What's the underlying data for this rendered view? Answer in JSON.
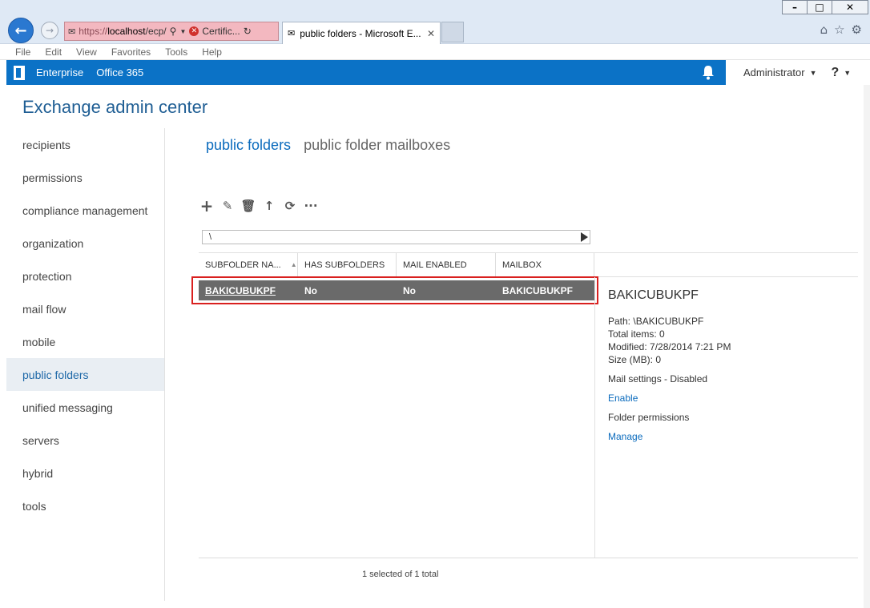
{
  "browser": {
    "address": {
      "prefix": "https://",
      "host": "localhost",
      "path": "/ecp/",
      "cert_label": "Certific..."
    },
    "tab_title": "public folders - Microsoft E...",
    "menu": [
      "File",
      "Edit",
      "View",
      "Favorites",
      "Tools",
      "Help"
    ]
  },
  "topnav": {
    "enterprise": "Enterprise",
    "office365": "Office 365",
    "admin": "Administrator",
    "help": "?"
  },
  "app_title": "Exchange admin center",
  "sidebar": {
    "items": [
      {
        "label": "recipients"
      },
      {
        "label": "permissions"
      },
      {
        "label": "compliance management"
      },
      {
        "label": "organization"
      },
      {
        "label": "protection"
      },
      {
        "label": "mail flow"
      },
      {
        "label": "mobile"
      },
      {
        "label": "public folders",
        "active": true
      },
      {
        "label": "unified messaging"
      },
      {
        "label": "servers"
      },
      {
        "label": "hybrid"
      },
      {
        "label": "tools"
      }
    ]
  },
  "tabs": [
    "public folders",
    "public folder mailboxes"
  ],
  "path": "\\",
  "grid": {
    "columns": [
      "SUBFOLDER NA...",
      "HAS SUBFOLDERS",
      "MAIL ENABLED",
      "MAILBOX"
    ],
    "rows": [
      [
        "BAKICUBUKPF",
        "No",
        "No",
        "BAKICUBUKPF"
      ]
    ]
  },
  "details": {
    "title": "BAKICUBUKPF",
    "path": "Path: \\BAKICUBUKPF",
    "total_items": "Total items: 0",
    "modified": "Modified: 7/28/2014 7:21 PM",
    "size": "Size (MB): 0",
    "mail_settings": "Mail settings - Disabled",
    "enable_link": "Enable",
    "folder_permissions": "Folder permissions",
    "manage_link": "Manage"
  },
  "status": "1 selected of 1 total",
  "colors": {
    "accent": "#0b72c6",
    "selected_row": "#6a6a6a",
    "highlight_box": "#d9201f"
  }
}
